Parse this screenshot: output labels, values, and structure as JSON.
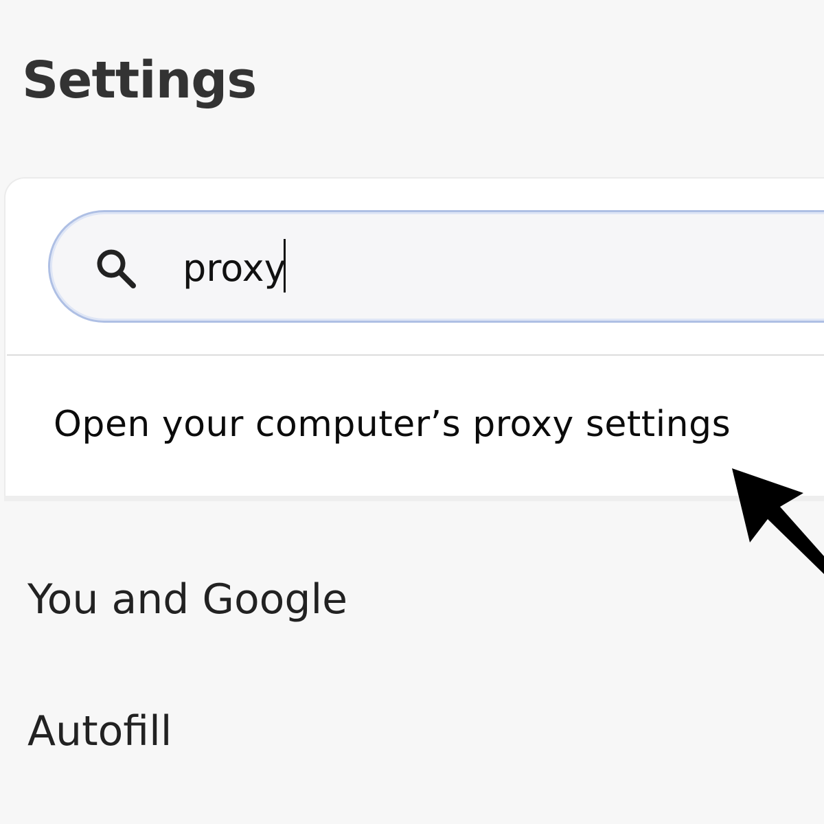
{
  "page": {
    "title": "Settings"
  },
  "search": {
    "icon": "search-icon",
    "value": "proxy",
    "accent_color": "#aebfe4"
  },
  "results": [
    {
      "label": "Open your computer’s proxy settings"
    }
  ],
  "nav": {
    "items": [
      {
        "label": "You and Google"
      },
      {
        "label": "Autofill"
      }
    ]
  },
  "annotation": {
    "icon": "pointer-arrow-icon",
    "color": "#000000"
  }
}
